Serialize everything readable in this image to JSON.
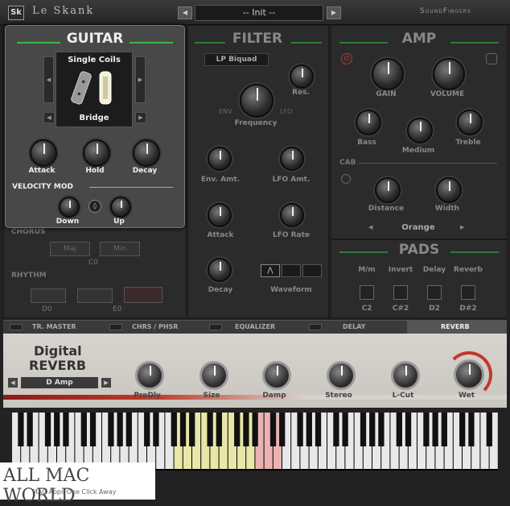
{
  "header": {
    "logo": "Sk",
    "title": "Le Skank",
    "preset": "-- Init --",
    "brand": "SoundFingers",
    "prev": "◀",
    "next": "▶"
  },
  "guitar": {
    "title": "GUITAR",
    "pickup_type": "Single Coils",
    "pickup_position": "Bridge",
    "knobs": [
      "Attack",
      "Hold",
      "Decay"
    ],
    "velocity_title": "VELOCITY MOD",
    "vel_knobs": [
      "Down",
      "Up"
    ]
  },
  "chorus": {
    "label": "CHORUS",
    "btn1": "Maj",
    "btn2": "Min",
    "note": "C0"
  },
  "rhythm": {
    "label": "RHYTHM",
    "note1": "D0",
    "note2": "E0"
  },
  "filter": {
    "title": "FILTER",
    "type": "LP Biquad",
    "res": "Res.",
    "frequency": "Frequency",
    "env_tag": "ENV",
    "lfo_tag": "LFO",
    "knobs": [
      "Env. Amt.",
      "LFO Amt.",
      "Attack",
      "LFO Rate",
      "Decay"
    ],
    "waveform": "Waveform"
  },
  "amp": {
    "title": "AMP",
    "knobs": [
      "GAIN",
      "VOLUME",
      "Bass",
      "Medium",
      "Treble"
    ],
    "cab_label": "CAB",
    "cab_knobs": [
      "Distance",
      "Width"
    ],
    "cab_model": "Orange"
  },
  "pads": {
    "title": "PADS",
    "cols": [
      "M/m",
      "Invert",
      "Delay",
      "Reverb"
    ],
    "notes": [
      "C2",
      "C#2",
      "D2",
      "D#2"
    ]
  },
  "tabs": [
    "TR. MASTER",
    "CHRS / PHSR",
    "EQUALIZER",
    "DELAY",
    "REVERB"
  ],
  "reverb": {
    "title_line1": "Digital",
    "title_line2": "REVERB",
    "preset": "D Amp",
    "knobs": [
      "PreDly",
      "Size",
      "Damp",
      "Stereo",
      "L-Cut",
      "Wet"
    ]
  },
  "watermark": {
    "text": "ALL MAC WORLD",
    "sub": "MAC Apps One Click Away"
  },
  "colors": {
    "accent_green": "#3db64a",
    "reverb_red": "#c0392b"
  }
}
